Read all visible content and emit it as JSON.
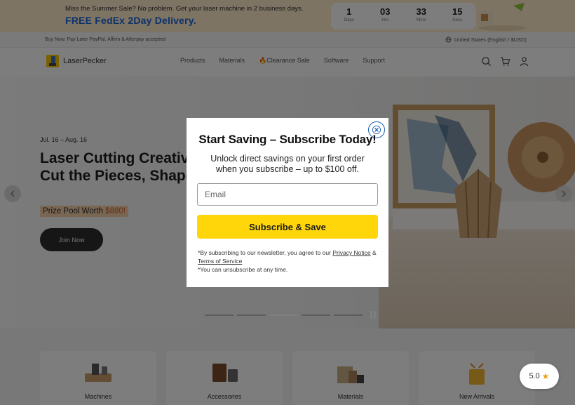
{
  "announcement": {
    "line1": "Miss the Summer Sale? No problem. Get your laser machine in 2 business days.",
    "line2": "FREE FedEx 2Day Delivery.",
    "countdown": [
      {
        "value": "1",
        "unit": "Days"
      },
      {
        "value": "03",
        "unit": "Hrs"
      },
      {
        "value": "33",
        "unit": "Mins"
      },
      {
        "value": "15",
        "unit": "Secs"
      }
    ]
  },
  "payments": {
    "text": "Buy Now. Pay Later PayPal, Affirm & Afterpay accepted",
    "region": "United States (English / $USD)"
  },
  "nav": {
    "logo": "LaserPecker",
    "menu": [
      "Products",
      "Materials",
      "Clearance Sale",
      "Software",
      "Support"
    ],
    "icons": [
      "search-icon",
      "cart-icon",
      "account-icon"
    ]
  },
  "hero": {
    "date": "Jul. 16 – Aug. 16",
    "title_line1": "Laser Cutting Creativ",
    "title_line2": "Cut the Pieces, Shape",
    "prize_label": "Prize Pool Worth ",
    "prize_amount": "$880!",
    "cta": "Join Now",
    "slides": 5,
    "active_slide": 3
  },
  "categories": [
    "Machines",
    "Accessories",
    "Materials",
    "New Arrivals"
  ],
  "modal": {
    "title": "Start Saving – Subscribe Today!",
    "subtitle_line1": "Unlock direct savings on your first order",
    "subtitle_line2": "when you subscribe – up to $100 off.",
    "email_placeholder": "Email",
    "button": "Subscribe & Save",
    "fine_print_1": "*By subscribing to our newsletter, you agree to our ",
    "privacy_link": "Privacy Notice",
    "fine_and": " & ",
    "terms_link": "Terms of Service",
    "fine_print_2": "*You can unsubscribe at any time."
  },
  "rating": {
    "value": "5.0"
  },
  "colors": {
    "accent_yellow": "#ffd60a",
    "delivery_blue": "#1a64d6",
    "close_ring": "#1a5fb4"
  }
}
